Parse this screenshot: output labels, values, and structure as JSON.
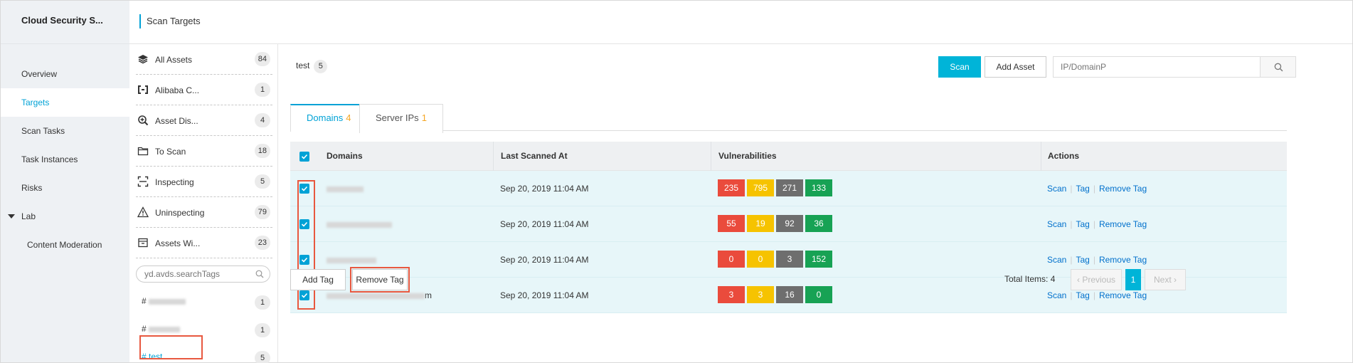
{
  "app": {
    "brand": "Cloud Security S..."
  },
  "header": {
    "title": "Scan Targets"
  },
  "sidebar": {
    "items": [
      {
        "label": "Overview"
      },
      {
        "label": "Targets"
      },
      {
        "label": "Scan Tasks"
      },
      {
        "label": "Task Instances"
      },
      {
        "label": "Risks"
      },
      {
        "label": "Lab"
      },
      {
        "label": "Content Moderation"
      }
    ]
  },
  "groups": [
    {
      "label": "All Assets",
      "count": "84",
      "icon": "layers-icon"
    },
    {
      "label": "Alibaba C...",
      "count": "1",
      "icon": "cloud-bracket-icon"
    },
    {
      "label": "Asset Dis...",
      "count": "4",
      "icon": "discover-icon"
    },
    {
      "label": "To Scan",
      "count": "18",
      "icon": "folder-icon"
    },
    {
      "label": "Inspecting",
      "count": "5",
      "icon": "scan-frame-icon"
    },
    {
      "label": "Uninspecting",
      "count": "79",
      "icon": "warning-icon"
    },
    {
      "label": "Assets Wi...",
      "count": "23",
      "icon": "box-icon"
    }
  ],
  "tag_search": {
    "placeholder": "yd.avds.searchTags"
  },
  "tags": [
    {
      "label": "#",
      "count": "1"
    },
    {
      "label": "#",
      "count": "1"
    },
    {
      "label": "# test",
      "count": "5"
    }
  ],
  "main": {
    "tag_name": "test",
    "tag_count": "5",
    "scan_label": "Scan",
    "add_asset_label": "Add Asset",
    "search_placeholder": "IP/DomainP",
    "tabs": [
      {
        "label": "Domains",
        "count": "4"
      },
      {
        "label": "Server IPs",
        "count": "1"
      }
    ],
    "table": {
      "headers": {
        "domains": "Domains",
        "last_scanned": "Last Scanned At",
        "vulnerabilities": "Vulnerabilities",
        "actions": "Actions"
      },
      "rows": [
        {
          "domain_suffix": "",
          "last_scanned": "Sep 20, 2019 11:04 AM",
          "vulns": [
            "235",
            "795",
            "271",
            "133"
          ]
        },
        {
          "domain_suffix": "",
          "last_scanned": "Sep 20, 2019 11:04 AM",
          "vulns": [
            "55",
            "19",
            "92",
            "36"
          ]
        },
        {
          "domain_suffix": "",
          "last_scanned": "Sep 20, 2019 11:04 AM",
          "vulns": [
            "0",
            "0",
            "3",
            "152"
          ]
        },
        {
          "domain_suffix": "m",
          "last_scanned": "Sep 20, 2019 11:04 AM",
          "vulns": [
            "3",
            "3",
            "16",
            "0"
          ]
        }
      ],
      "actions": {
        "scan": "Scan",
        "tag": "Tag",
        "remove_tag": "Remove Tag",
        "separator": "|"
      }
    },
    "footer": {
      "add_tag": "Add Tag",
      "remove_tag": "Remove Tag",
      "total_items": "Total Items: 4",
      "previous": "Previous",
      "page": "1",
      "next": "Next"
    }
  },
  "colors": {
    "accent": "#00a2d6",
    "vuln_high": "#ea4b3c",
    "vuln_medium": "#f6c300",
    "vuln_low": "#6e6e6e",
    "vuln_info": "#17a254",
    "highlight": "#e8583f"
  }
}
